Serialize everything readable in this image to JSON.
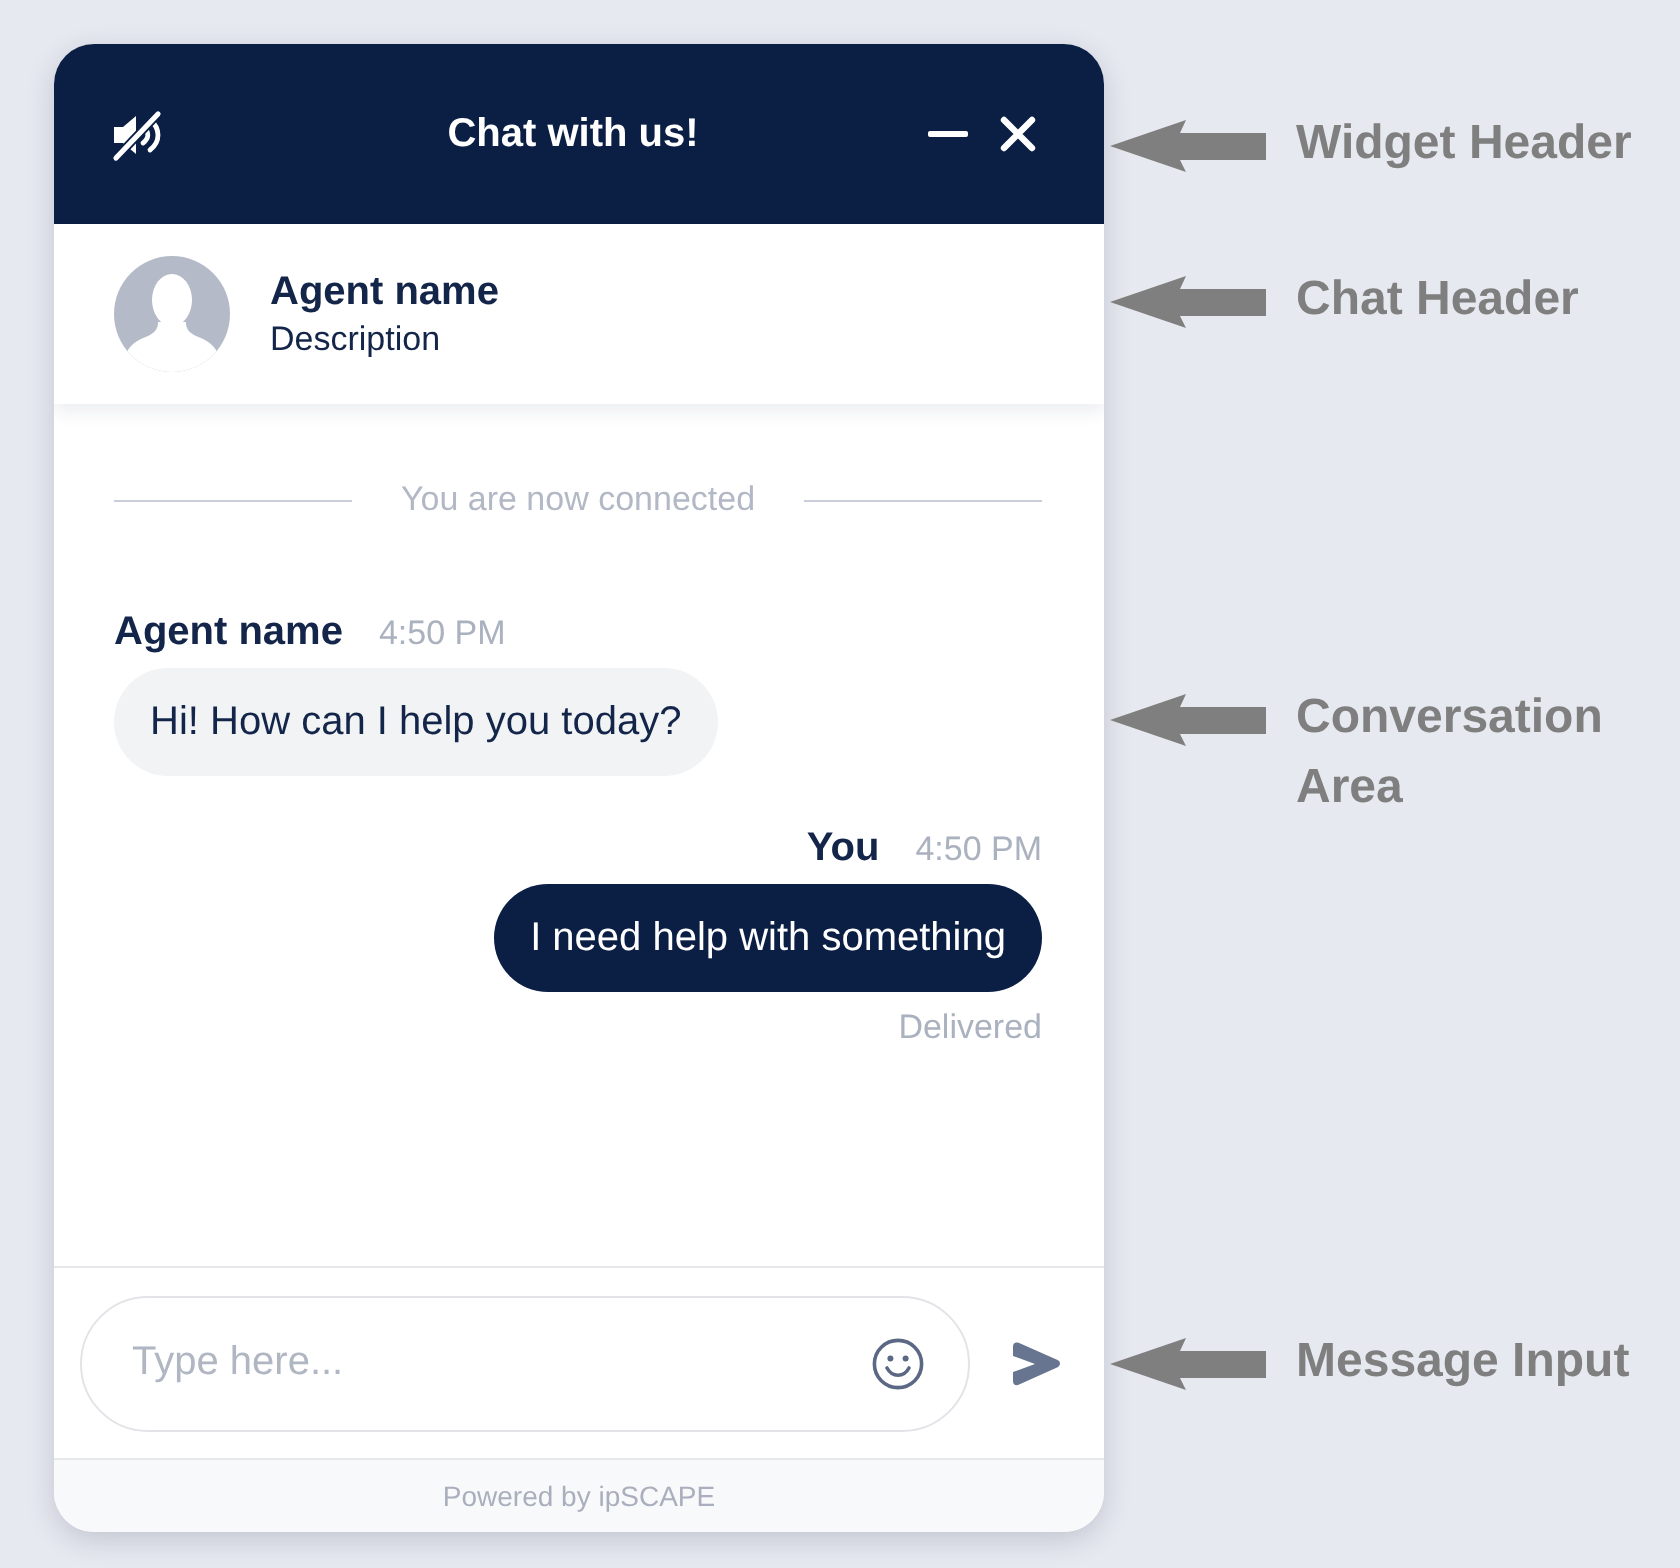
{
  "widget_header": {
    "title": "Chat with us!"
  },
  "chat_header": {
    "agent_name": "Agent name",
    "description": "Description"
  },
  "conversation": {
    "notice": "You are now connected",
    "messages": [
      {
        "kind": "agent",
        "sender": "Agent name",
        "time": "4:50 PM",
        "text": "Hi! How can I help you today?"
      },
      {
        "kind": "user",
        "sender": "You",
        "time": "4:50 PM",
        "text": "I need help with something",
        "status": "Delivered"
      }
    ]
  },
  "message_input": {
    "placeholder": "Type here..."
  },
  "footer": {
    "text": "Powered by ipSCAPE"
  },
  "annotations": [
    {
      "label": "Widget Header"
    },
    {
      "label": "Chat Header"
    },
    {
      "label": "Conversation Area"
    },
    {
      "label": "Message Input"
    }
  ]
}
